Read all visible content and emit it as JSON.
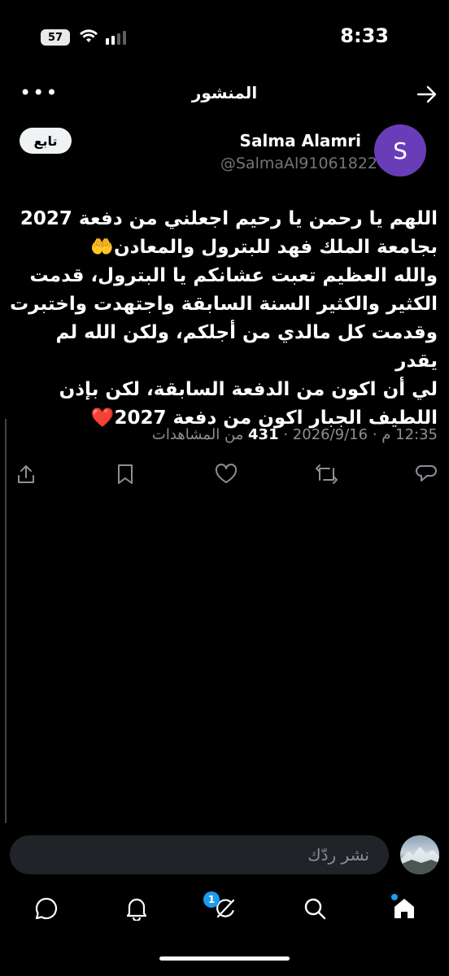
{
  "status_bar": {
    "time": "8:33",
    "battery": "57"
  },
  "header": {
    "title": "المنشور",
    "more": "•••"
  },
  "post": {
    "author_name": "Salma Alamri",
    "author_handle": "@SalmaAl91061822",
    "avatar_letter": "S",
    "follow_label": "تابع",
    "lines": [
      "اللهم يا رحمن يا رحيم اجعلني من دفعة 2027",
      "بجامعة الملك فهد للبترول والمعادن🤲",
      "والله العظيم تعبت عشانكم يا البترول، قدمت",
      "الكثير والكثير السنة السابقة واجتهدت واختبرت",
      "وقدمت كل مالدي من أجلكم، ولكن الله لم يقدر",
      "لي أن اكون من الدفعة السابقة، لكن بإذن",
      "اللطيف الجبار اكون من دفعة 2027"
    ],
    "heart_emoji": "❤️",
    "meta_time": "12:35 م · 2026/9/16 ·",
    "views_count": "431",
    "views_label": "من المشاهدات"
  },
  "reply": {
    "placeholder": "نشر ردّك"
  },
  "tabbar": {
    "notifications_badge": "1"
  },
  "colors": {
    "background": "#000000",
    "accent": "#1d9bf0",
    "avatar": "#6a3db8"
  }
}
